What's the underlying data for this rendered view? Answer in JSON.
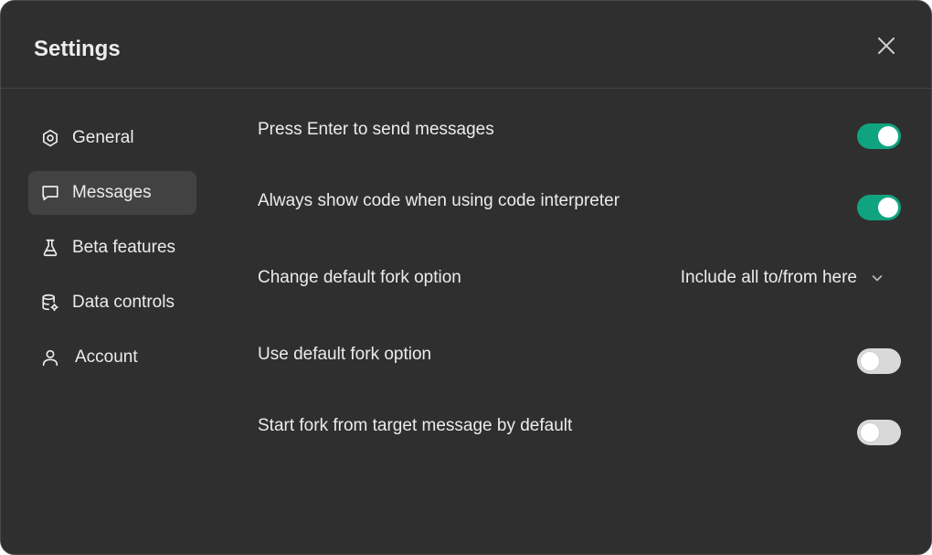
{
  "dialog": {
    "title": "Settings",
    "close_icon": "close-icon"
  },
  "sidebar": {
    "items": [
      {
        "label": "General",
        "icon": "gear-icon",
        "active": false
      },
      {
        "label": "Messages",
        "icon": "message-icon",
        "active": true
      },
      {
        "label": "Beta features",
        "icon": "flask-icon",
        "active": false
      },
      {
        "label": "Data controls",
        "icon": "database-gear-icon",
        "active": false
      },
      {
        "label": "Account",
        "icon": "user-icon",
        "active": false
      }
    ]
  },
  "settings": {
    "rows": [
      {
        "label": "Press Enter to send messages",
        "control": "toggle",
        "on": true
      },
      {
        "label": "Always show code when using code interpreter",
        "control": "toggle",
        "on": true
      },
      {
        "label": "Change default fork option",
        "control": "dropdown",
        "value": "Include all to/from here"
      },
      {
        "label": "Use default fork option",
        "control": "toggle",
        "on": false
      },
      {
        "label": "Start fork from target message by default",
        "control": "toggle",
        "on": false
      }
    ]
  },
  "colors": {
    "background": "#2f2f2f",
    "active_nav": "#424242",
    "toggle_on": "#10a37f",
    "toggle_off": "#d9d9d9",
    "text": "#ececec"
  }
}
